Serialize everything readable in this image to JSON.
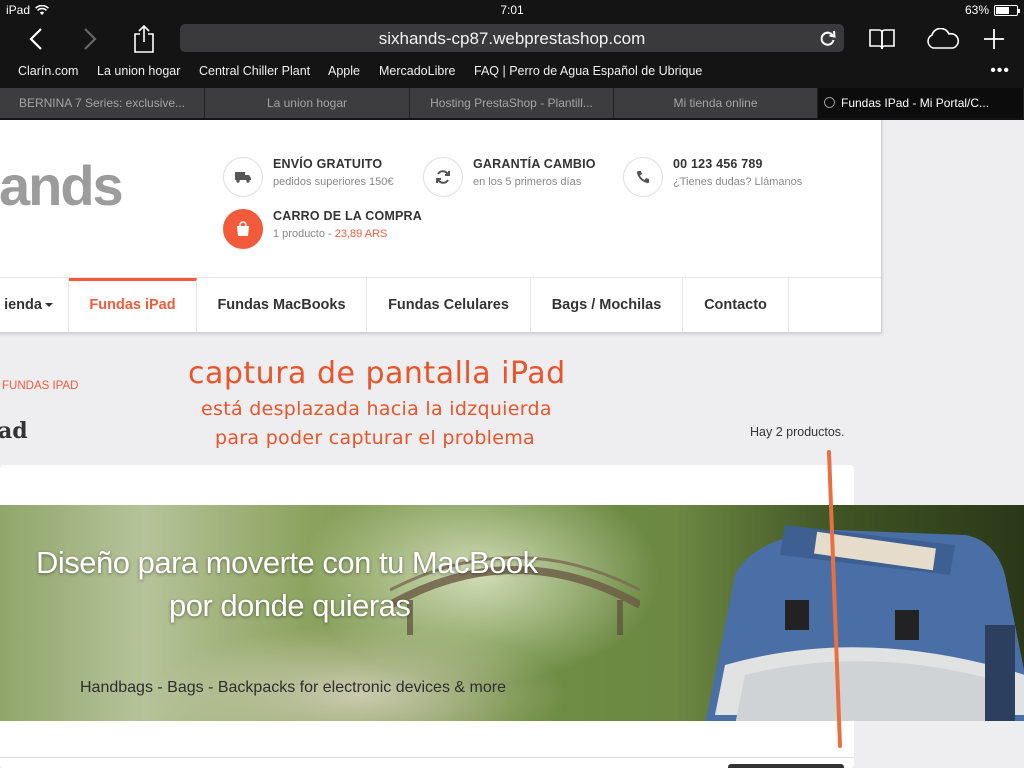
{
  "status": {
    "device": "iPad",
    "time": "7:01",
    "battery": "63%",
    "battery_level": 0.63
  },
  "browser": {
    "url": "sixhands-cp87.webprestashop.com",
    "bookmarks": [
      "Clarín.com",
      "La union hogar",
      "Central Chiller Plant",
      "Apple",
      "MercadoLibre",
      "FAQ | Perro de Agua Español de Ubrique"
    ],
    "tabs": [
      {
        "title": "BERNINA 7 Series: exclusive..."
      },
      {
        "title": "La union hogar"
      },
      {
        "title": "Hosting PrestaShop - Plantill..."
      },
      {
        "title": "Mi tienda online"
      },
      {
        "title": "Fundas IPad - Mi Portal/C..."
      }
    ]
  },
  "site": {
    "logo_text": "ands",
    "shipping": {
      "title": "ENVÍO GRATUITO",
      "sub": "pedidos superiores 150€"
    },
    "exchange": {
      "title": "GARANTÍA CAMBIO",
      "sub": "en los 5 primeros días"
    },
    "phone": {
      "title": "00 123 456 789",
      "sub": "¿Tienes dudas? Llámanos"
    },
    "cart": {
      "title": "CARRO DE LA COMPRA",
      "sub": "1 producto -",
      "price": "23,89 ARS"
    },
    "nav": [
      "ienda",
      "Fundas iPad",
      "Fundas MacBooks",
      "Fundas Celulares",
      "Bags / Mochilas",
      "Contacto"
    ],
    "breadcrumb": "FUNDAS IPAD",
    "heading": "ad",
    "product_count": "Hay 2 productos."
  },
  "annotation": {
    "line1": "captura de pantalla iPad",
    "line2": "está desplazada hacia la idzquierda",
    "line3": "para poder capturar el problema"
  },
  "banner": {
    "line1": "Diseño para moverte con tu MacBook",
    "line2": "por donde quieras",
    "tagline": "Handbags - Bags - Backpacks for electronic devices & more"
  }
}
